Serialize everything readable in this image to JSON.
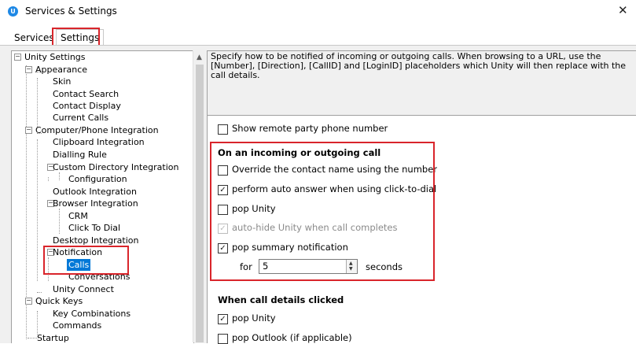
{
  "window": {
    "title": "Services & Settings",
    "close_glyph": "✕",
    "app_icon": "unity-app-icon"
  },
  "tabs": [
    {
      "label": "Services"
    },
    {
      "label": "Settings",
      "selected": true
    }
  ],
  "tree": {
    "items": [
      {
        "label": "Unity Settings"
      },
      {
        "label": "Appearance"
      },
      {
        "label": "Skin"
      },
      {
        "label": "Contact Search"
      },
      {
        "label": "Contact Display"
      },
      {
        "label": "Current Calls"
      },
      {
        "label": "Computer/Phone Integration"
      },
      {
        "label": "Clipboard Integration"
      },
      {
        "label": "Dialling Rule"
      },
      {
        "label": "Custom Directory Integration"
      },
      {
        "label": "Configuration"
      },
      {
        "label": "Outlook Integration"
      },
      {
        "label": "Browser Integration"
      },
      {
        "label": "CRM"
      },
      {
        "label": "Click To Dial"
      },
      {
        "label": "Desktop Integration"
      },
      {
        "label": "Notification"
      },
      {
        "label": "Calls",
        "selected": true
      },
      {
        "label": "Conversations"
      },
      {
        "label": "Unity Connect"
      },
      {
        "label": "Quick Keys"
      },
      {
        "label": "Key Combinations"
      },
      {
        "label": "Commands"
      },
      {
        "label": "Startup"
      }
    ]
  },
  "description": "Specify how to be notified of incoming or outgoing calls.  When browsing to a URL, use the [Number], [Direction], [CallID] and [LoginID] placeholders which Unity will then replace with the call details.",
  "options": {
    "show_remote_party": {
      "label": "Show remote party phone number",
      "checked": false
    },
    "incoming_group": {
      "title": "On an incoming or outgoing call",
      "override_contact": {
        "label": "Override the contact name using the number",
        "checked": false
      },
      "auto_answer": {
        "label": "perform auto answer when using click-to-dial",
        "checked": true
      },
      "pop_unity": {
        "label": "pop Unity",
        "checked": false
      },
      "auto_hide": {
        "label": "auto-hide Unity when call completes",
        "checked": true,
        "disabled": true
      },
      "pop_summary": {
        "label": "pop summary notification",
        "checked": true
      },
      "for_label": "for",
      "seconds_value": "5",
      "seconds_label": "seconds"
    },
    "details_group": {
      "title": "When call details clicked",
      "pop_unity": {
        "label": "pop Unity",
        "checked": true
      },
      "pop_outlook": {
        "label": "pop Outlook (if applicable)",
        "checked": false
      }
    }
  },
  "colors": {
    "highlight": "#d9252b",
    "selection": "#0078d7"
  }
}
